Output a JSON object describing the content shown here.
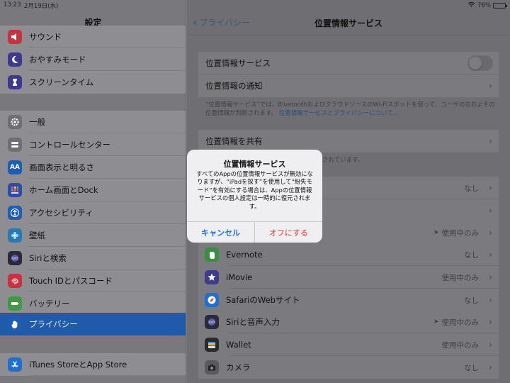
{
  "status": {
    "time": "13:23",
    "date": "2月19日(水)",
    "battery": "76%",
    "battery_level": 0.76
  },
  "master": {
    "title": "設定",
    "items": [
      {
        "label": "サウンド",
        "icon": "sound-icon",
        "color": "#c8313f"
      },
      {
        "label": "おやすみモード",
        "icon": "moon-icon",
        "color": "#3d3a8e"
      },
      {
        "label": "スクリーンタイム",
        "icon": "hourglass-icon",
        "color": "#3d3a8e"
      },
      {
        "label": "一般",
        "icon": "gear-icon",
        "color": "#6f6f73"
      },
      {
        "label": "コントロールセンター",
        "icon": "toggles-icon",
        "color": "#6f6f73"
      },
      {
        "label": "画面表示と明るさ",
        "icon": "text-size-icon",
        "color": "#1e5db6"
      },
      {
        "label": "ホーム画面とDock",
        "icon": "grid-icon",
        "color": "#2b4da5"
      },
      {
        "label": "アクセシビリティ",
        "icon": "accessibility-icon",
        "color": "#1e5db6"
      },
      {
        "label": "壁紙",
        "icon": "flower-icon",
        "color": "#2a7ab0"
      },
      {
        "label": "Siriと検索",
        "icon": "siri-icon",
        "color": "#2a2a3a"
      },
      {
        "label": "Touch IDとパスコード",
        "icon": "fingerprint-icon",
        "color": "#c8313f"
      },
      {
        "label": "バッテリー",
        "icon": "battery-icon",
        "color": "#3f9a48"
      },
      {
        "label": "プライバシー",
        "icon": "hand-icon",
        "color": "#1e5db6"
      },
      {
        "label": "iTunes StoreとApp Store",
        "icon": "app-store-icon",
        "color": "#1e6fd0"
      }
    ]
  },
  "detail": {
    "back_label": "プライバシー",
    "title": "位置情報サービス",
    "location_services_label": "位置情報サービス",
    "location_services_on": false,
    "location_alerts_label": "位置情報の通知",
    "footnote": "“位置情報サービス”では、BluetoothおよびクラウドソースのWi-Fiスポットを使って、ユーザのおおよその位置情報が判断されます。",
    "footnote_link": "位置情報サービスとプライバシーについて…",
    "share_label": "位置情報を共有",
    "share_footnote": "されています。",
    "apps": [
      {
        "name": "",
        "value": "なし",
        "icon": "",
        "color": ""
      },
      {
        "name": "",
        "value": "",
        "icon": "",
        "color": ""
      },
      {
        "name": "",
        "value": "使用中のみ",
        "arrow": true,
        "icon": "",
        "color": ""
      },
      {
        "name": "Evernote",
        "value": "なし",
        "icon": "evernote-icon",
        "color": "#3a8e42"
      },
      {
        "name": "iMovie",
        "value": "使用中のみ",
        "icon": "imovie-icon",
        "color": "#3e3a8e"
      },
      {
        "name": "SafariのWebサイト",
        "value": "なし",
        "icon": "safari-icon",
        "color": "#1e6fd0"
      },
      {
        "name": "Siriと音声入力",
        "value": "使用中のみ",
        "arrow": true,
        "icon": "siri-icon",
        "color": "#2a2a3a"
      },
      {
        "name": "Wallet",
        "value": "使用中のみ",
        "icon": "wallet-icon",
        "color": "#2a2a2a"
      },
      {
        "name": "カメラ",
        "value": "なし",
        "icon": "camera-icon",
        "color": "#5a5a5e"
      }
    ]
  },
  "alert": {
    "title": "位置情報サービス",
    "message": "すべてのAppの位置情報サービスが無効になりますが、“iPadを探す”を使用して“紛失モード”を有効にする場合は、Appの位置情報サービスの個人設定は一時的に復元されます。",
    "cancel_label": "キャンセル",
    "confirm_label": "オフにする"
  }
}
